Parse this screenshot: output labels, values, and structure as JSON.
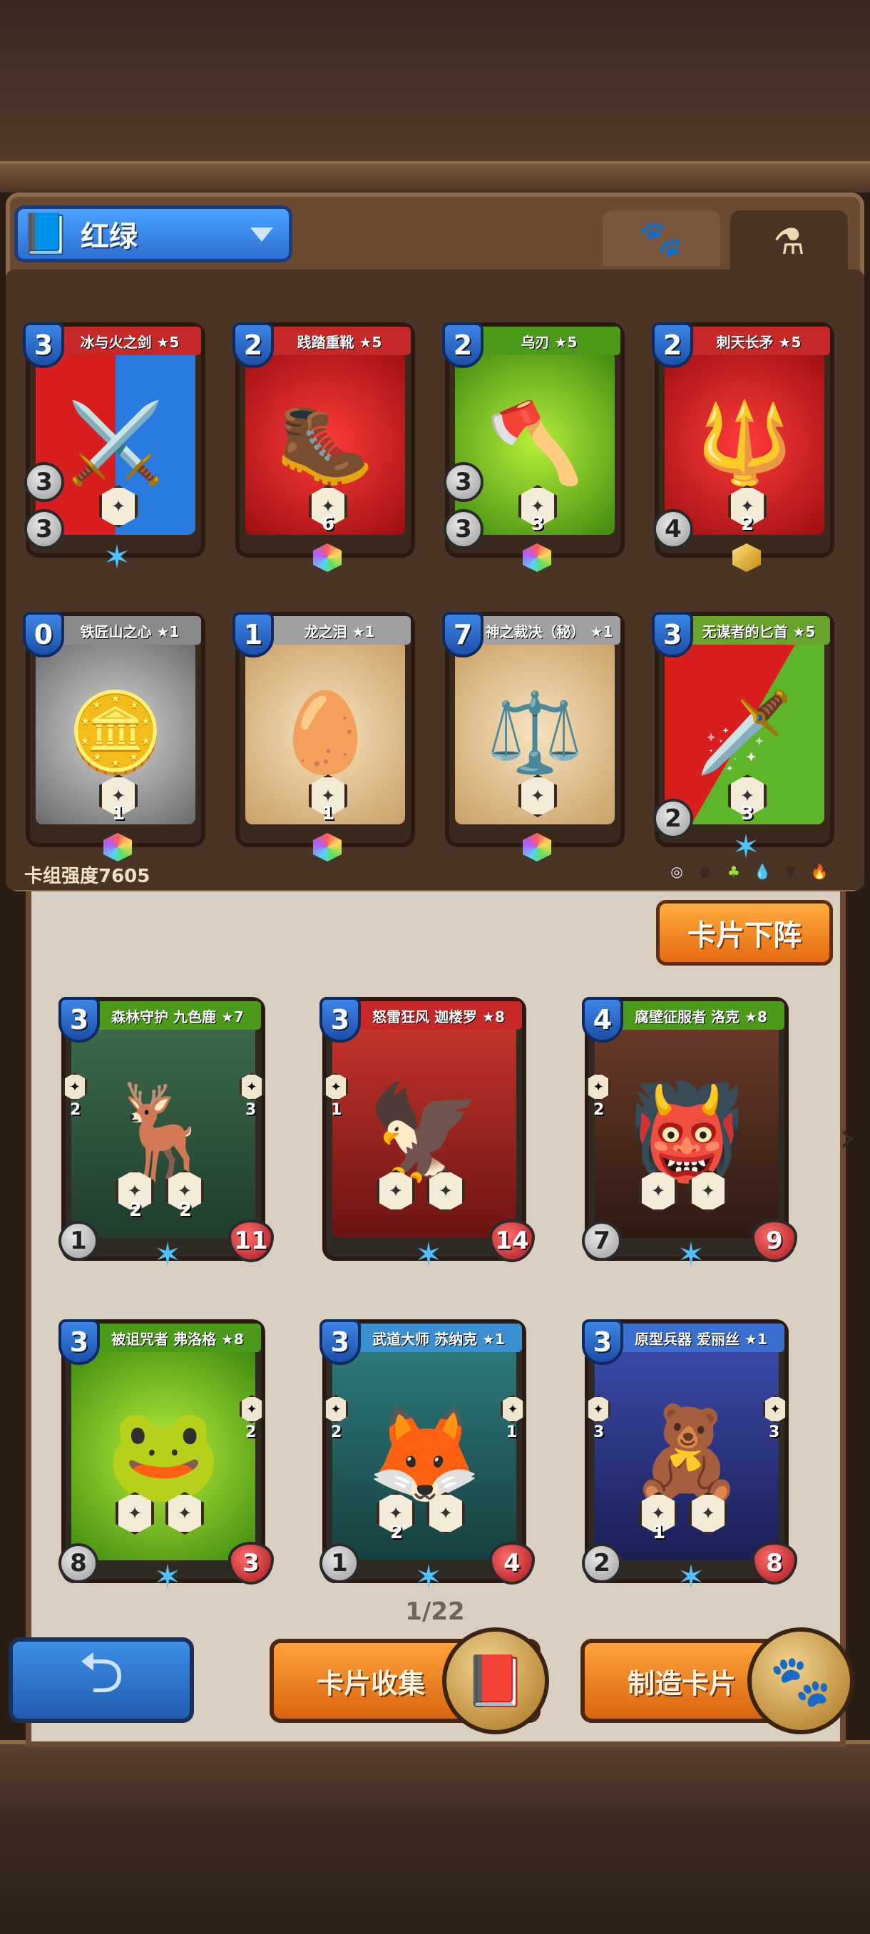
{
  "header": {
    "deck_name": "红绿",
    "tab_paw_icon": "paw-icon",
    "tab_potion_icon": "potion-icon"
  },
  "deck_cards": [
    {
      "name": "冰与火之剑 ★5",
      "cost": "3",
      "atk": "3",
      "def": "3",
      "icon": "⚔️",
      "theme": "redblue",
      "badge": "",
      "rarity": "blue-star"
    },
    {
      "name": "践踏重靴 ★5",
      "cost": "2",
      "atk": "",
      "def": "",
      "icon": "🥾",
      "theme": "red",
      "badge": "6",
      "rarity": "rainbow"
    },
    {
      "name": "乌刃 ★5",
      "cost": "2",
      "atk": "3",
      "def": "3",
      "icon": "🪓",
      "theme": "green",
      "badge": "3",
      "rarity": "rainbow"
    },
    {
      "name": "刺天长矛 ★5",
      "cost": "2",
      "atk": "",
      "def": "4",
      "icon": "🔱",
      "theme": "red",
      "badge": "2",
      "rarity": "gold"
    },
    {
      "name": "铁匠山之心 ★1",
      "cost": "0",
      "atk": "",
      "def": "",
      "icon": "🪙",
      "theme": "gray",
      "badge": "1",
      "rarity": "rainbow"
    },
    {
      "name": "龙之泪 ★1",
      "cost": "1",
      "atk": "",
      "def": "",
      "icon": "🥚",
      "theme": "tan",
      "badge": "1",
      "rarity": "rainbow"
    },
    {
      "name": "神之裁决（秘） ★1",
      "cost": "7",
      "atk": "",
      "def": "",
      "icon": "⚖️",
      "theme": "tan",
      "badge": "",
      "rarity": "rainbow"
    },
    {
      "name": "无谋者的匕首 ★5",
      "cost": "3",
      "atk": "",
      "def": "2",
      "icon": "🗡️",
      "theme": "redgreen",
      "badge": "3",
      "rarity": "blue-star"
    }
  ],
  "deck_power": "卡组强度7605",
  "element_icons": [
    "◎",
    "●",
    "♣",
    "💧",
    "▼",
    "🔥"
  ],
  "remove_button": "卡片下阵",
  "collection_cards": [
    {
      "name": "森林守护 九色鹿 ★7",
      "cost": "3",
      "atk": "1",
      "hp": "11",
      "left": "2",
      "right": "3",
      "b1": "2",
      "b2": "2",
      "icon": "🦌",
      "theme": "forest"
    },
    {
      "name": "怒雷狂风 迦楼罗 ★8",
      "cost": "3",
      "atk": "",
      "hp": "14",
      "left": "1",
      "right": "",
      "b1": "",
      "b2": "",
      "icon": "🦅",
      "theme": "fire"
    },
    {
      "name": "腐壁征服者 洛克 ★8",
      "cost": "4",
      "atk": "7",
      "hp": "9",
      "left": "2",
      "right": "",
      "b1": "",
      "b2": "",
      "icon": "👹",
      "theme": "darkred"
    },
    {
      "name": "被诅咒者 弗洛格 ★8",
      "cost": "3",
      "atk": "8",
      "hp": "3",
      "left": "",
      "right": "2",
      "b1": "",
      "b2": "",
      "icon": "🐸",
      "theme": "green"
    },
    {
      "name": "武道大师 苏纳克 ★1",
      "cost": "3",
      "atk": "1",
      "hp": "4",
      "left": "2",
      "right": "1",
      "b1": "2",
      "b2": "",
      "icon": "🦊",
      "theme": "teal"
    },
    {
      "name": "原型兵器 爱丽丝 ★1",
      "cost": "3",
      "atk": "2",
      "hp": "8",
      "left": "3",
      "right": "3",
      "b1": "1",
      "b2": "",
      "icon": "🧸",
      "theme": "blue"
    }
  ],
  "page_indicator": "1/22",
  "bottom_buttons": {
    "collection": "卡片收集",
    "craft": "制造卡片"
  }
}
